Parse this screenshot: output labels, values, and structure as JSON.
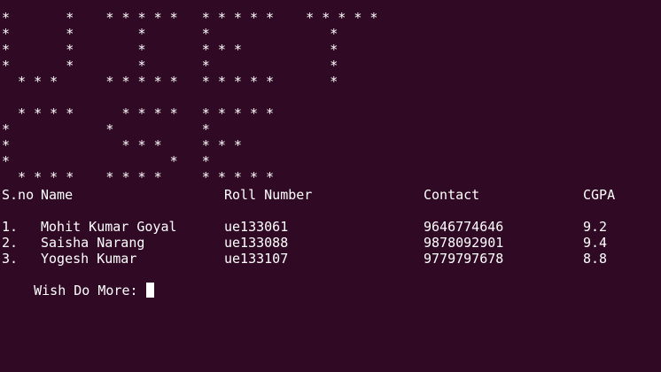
{
  "terminal": {
    "background": "#300a24",
    "foreground": "#ffffff",
    "banner": [
      "*       *    * * * * *   * * * * *    * * * * *",
      "*       *        *       *               *",
      "*       *        *       * * *           *",
      "*       *        *       *               *",
      "  * * *      * * * * *   * * * * *       *",
      "",
      "  * * * *      * * * *   * * * * *",
      "*            *           *",
      "*              * * *     * * *",
      "*                    *   *",
      "  * * * *    * * * *     * * * * *"
    ],
    "table": {
      "headers": [
        "S.no",
        "Name",
        "Roll Number",
        "Contact",
        "CGPA"
      ],
      "rows": [
        {
          "sno": "1.",
          "name": "Mohit Kumar Goyal",
          "roll": "ue133061",
          "contact": "9646774646",
          "cgpa": "9.2"
        },
        {
          "sno": "2.",
          "name": "Saisha Narang",
          "roll": "ue133088",
          "contact": "9878092901",
          "cgpa": "9.4"
        },
        {
          "sno": "3.",
          "name": "Yogesh Kumar",
          "roll": "ue133107",
          "contact": "9779797678",
          "cgpa": "8.8"
        }
      ]
    },
    "prompt": "Wish Do More: "
  }
}
